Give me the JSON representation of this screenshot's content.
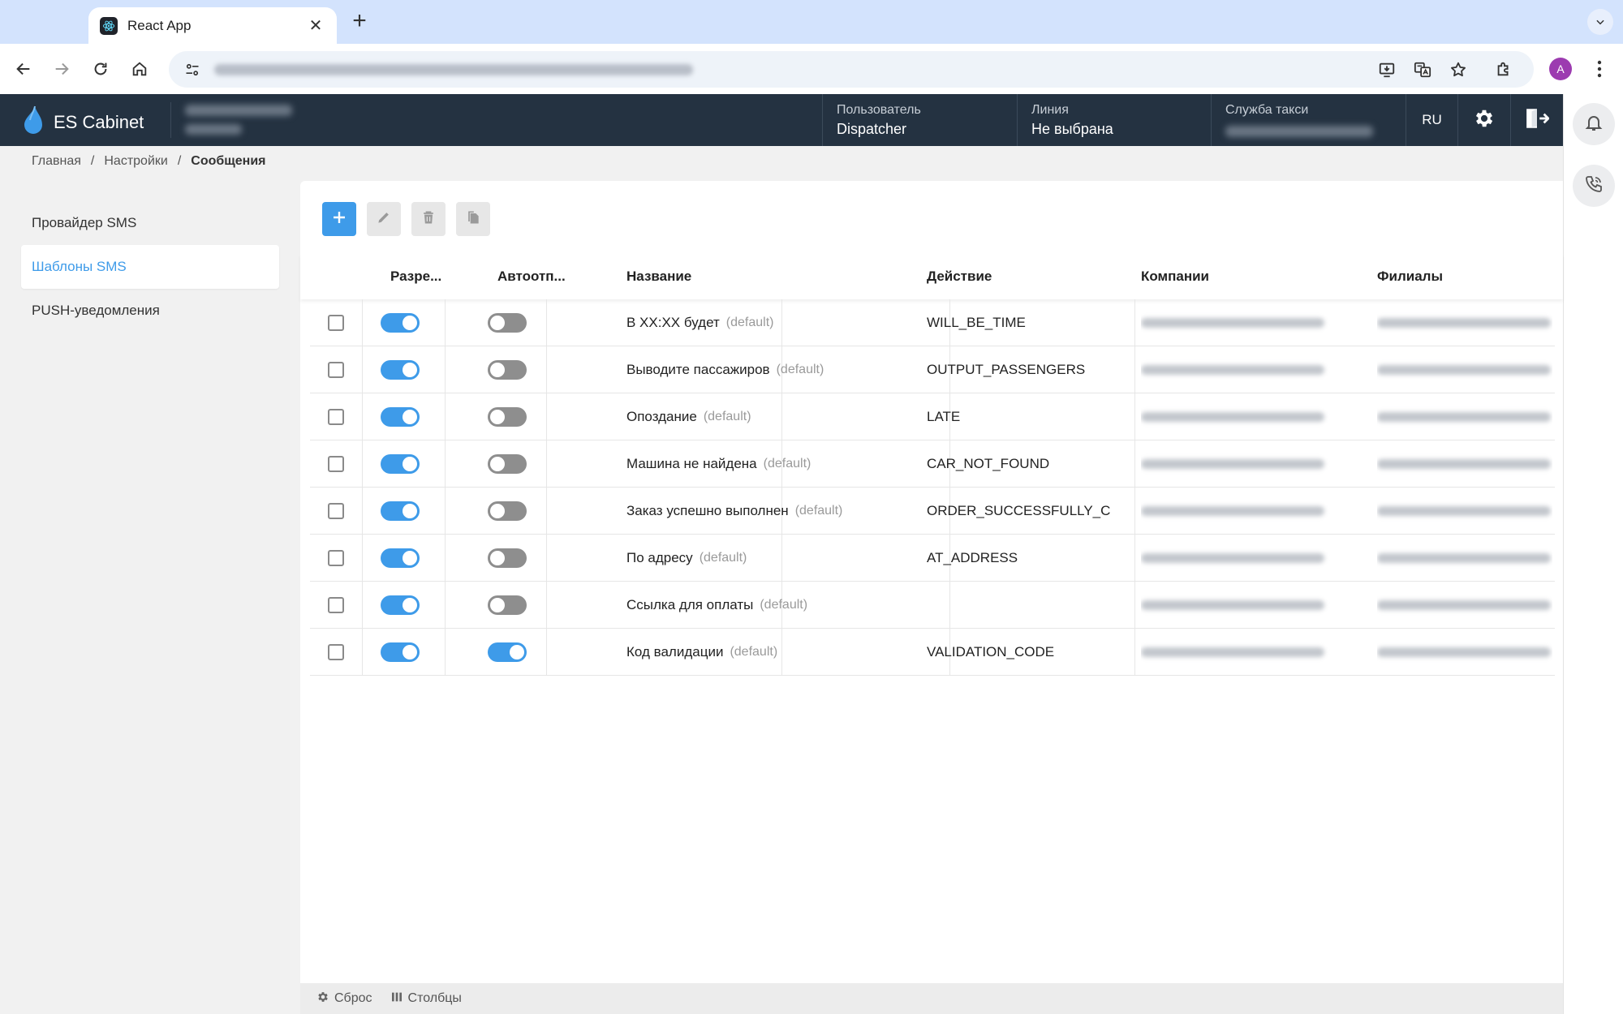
{
  "browser": {
    "tab_title": "React App",
    "new_tab_symbol": "+",
    "profile_initial": "A"
  },
  "header": {
    "brand": "ES Cabinet",
    "user_label": "Пользователь",
    "user_value": "Dispatcher",
    "line_label": "Линия",
    "line_value": "Не выбрана",
    "taxi_label": "Служба такси",
    "lang": "RU"
  },
  "breadcrumb": {
    "items": [
      "Главная",
      "Настройки",
      "Сообщения"
    ],
    "separator": "/"
  },
  "sidebar": {
    "items": [
      {
        "label": "Провайдер SMS",
        "active": false
      },
      {
        "label": "Шаблоны SMS",
        "active": true
      },
      {
        "label": "PUSH-уведомления",
        "active": false
      }
    ]
  },
  "table": {
    "columns": [
      "Разре...",
      "Автоотп...",
      "Название",
      "Действие",
      "Компании",
      "Филиалы"
    ],
    "rows": [
      {
        "enabled": true,
        "auto": false,
        "name": "В XX:XX будет",
        "tag": "(default)",
        "action": "WILL_BE_TIME"
      },
      {
        "enabled": true,
        "auto": false,
        "name": "Выводите пассажиров",
        "tag": "(default)",
        "action": "OUTPUT_PASSENGERS"
      },
      {
        "enabled": true,
        "auto": false,
        "name": "Опоздание",
        "tag": "(default)",
        "action": "LATE"
      },
      {
        "enabled": true,
        "auto": false,
        "name": "Машина не найдена",
        "tag": "(default)",
        "action": "CAR_NOT_FOUND"
      },
      {
        "enabled": true,
        "auto": false,
        "name": "Заказ успешно выполнен",
        "tag": "(default)",
        "action": "ORDER_SUCCESSFULLY_COM"
      },
      {
        "enabled": true,
        "auto": false,
        "name": "По адресу",
        "tag": "(default)",
        "action": "AT_ADDRESS"
      },
      {
        "enabled": true,
        "auto": false,
        "name": "Ссылка для оплаты",
        "tag": "(default)",
        "action": ""
      },
      {
        "enabled": true,
        "auto": true,
        "name": "Код валидации",
        "tag": "(default)",
        "action": "VALIDATION_CODE"
      }
    ]
  },
  "footer": {
    "reset_label": "Сброс",
    "columns_label": "Столбцы"
  },
  "colors": {
    "accent": "#3e9be9",
    "header_bg": "#243241",
    "tab_strip": "#d3e3fd"
  }
}
